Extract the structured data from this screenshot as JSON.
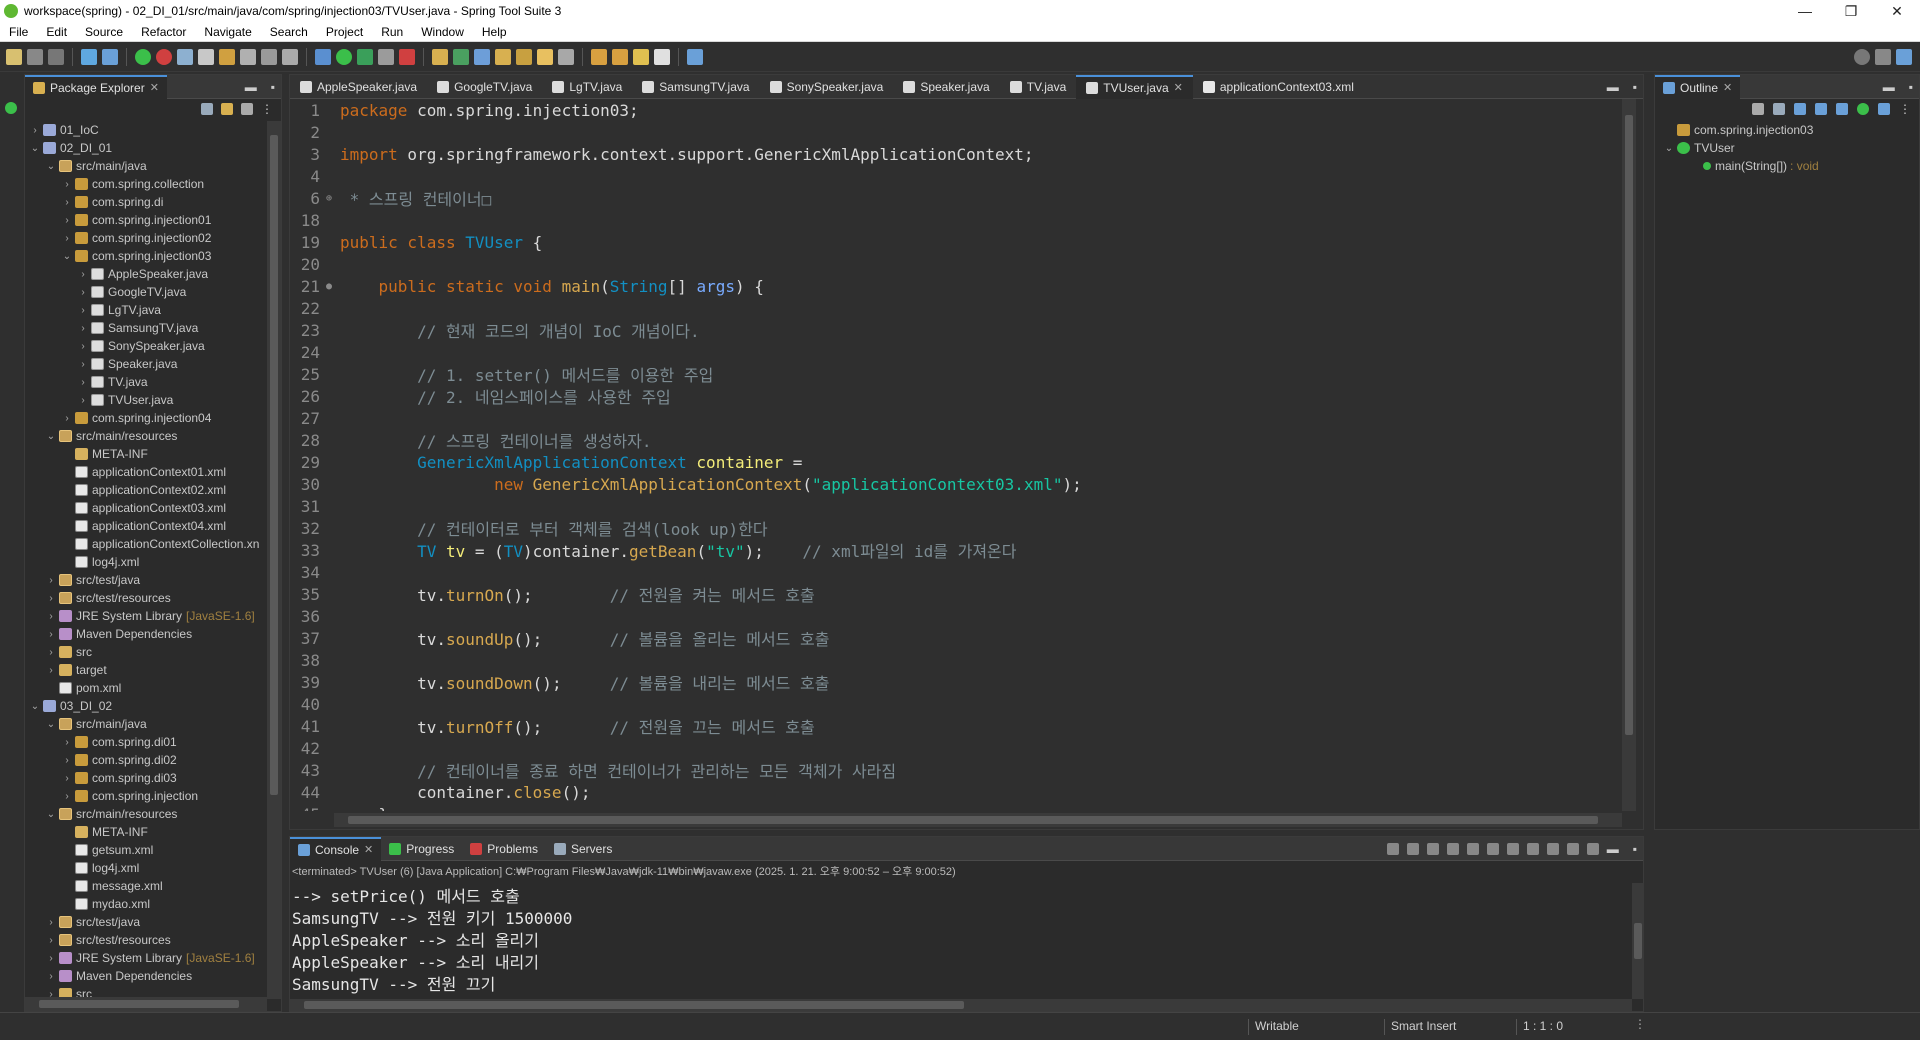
{
  "window": {
    "title": "workspace(spring) - 02_DI_01/src/main/java/com/spring/injection03/TVUser.java - Spring Tool Suite 3",
    "controls": [
      "—",
      "❐",
      "✕"
    ]
  },
  "menu": [
    "File",
    "Edit",
    "Source",
    "Refactor",
    "Navigate",
    "Search",
    "Project",
    "Run",
    "Window",
    "Help"
  ],
  "package_explorer": {
    "tab_label": "Package Explorer",
    "items": [
      {
        "indent": 0,
        "twisty": "›",
        "icon": "proj",
        "label": "01_IoC",
        "extra": ""
      },
      {
        "indent": 0,
        "twisty": "⌄",
        "icon": "proj",
        "label": "02_DI_01",
        "extra": ""
      },
      {
        "indent": 1,
        "twisty": "⌄",
        "icon": "src",
        "label": "src/main/java",
        "extra": ""
      },
      {
        "indent": 2,
        "twisty": "›",
        "icon": "pkg",
        "label": "com.spring.collection",
        "extra": ""
      },
      {
        "indent": 2,
        "twisty": "›",
        "icon": "pkg",
        "label": "com.spring.di",
        "extra": ""
      },
      {
        "indent": 2,
        "twisty": "›",
        "icon": "pkg",
        "label": "com.spring.injection01",
        "extra": ""
      },
      {
        "indent": 2,
        "twisty": "›",
        "icon": "pkg",
        "label": "com.spring.injection02",
        "extra": ""
      },
      {
        "indent": 2,
        "twisty": "⌄",
        "icon": "pkg",
        "label": "com.spring.injection03",
        "extra": ""
      },
      {
        "indent": 3,
        "twisty": "›",
        "icon": "java",
        "label": "AppleSpeaker.java",
        "extra": ""
      },
      {
        "indent": 3,
        "twisty": "›",
        "icon": "java",
        "label": "GoogleTV.java",
        "extra": ""
      },
      {
        "indent": 3,
        "twisty": "›",
        "icon": "java",
        "label": "LgTV.java",
        "extra": ""
      },
      {
        "indent": 3,
        "twisty": "›",
        "icon": "java",
        "label": "SamsungTV.java",
        "extra": ""
      },
      {
        "indent": 3,
        "twisty": "›",
        "icon": "java",
        "label": "SonySpeaker.java",
        "extra": ""
      },
      {
        "indent": 3,
        "twisty": "›",
        "icon": "java",
        "label": "Speaker.java",
        "extra": ""
      },
      {
        "indent": 3,
        "twisty": "›",
        "icon": "java",
        "label": "TV.java",
        "extra": ""
      },
      {
        "indent": 3,
        "twisty": "›",
        "icon": "java",
        "label": "TVUser.java",
        "extra": ""
      },
      {
        "indent": 2,
        "twisty": "›",
        "icon": "pkg",
        "label": "com.spring.injection04",
        "extra": ""
      },
      {
        "indent": 1,
        "twisty": "⌄",
        "icon": "src",
        "label": "src/main/resources",
        "extra": ""
      },
      {
        "indent": 2,
        "twisty": "",
        "icon": "folder",
        "label": "META-INF",
        "extra": ""
      },
      {
        "indent": 2,
        "twisty": "",
        "icon": "xml",
        "label": "applicationContext01.xml",
        "extra": ""
      },
      {
        "indent": 2,
        "twisty": "",
        "icon": "xml",
        "label": "applicationContext02.xml",
        "extra": ""
      },
      {
        "indent": 2,
        "twisty": "",
        "icon": "xml",
        "label": "applicationContext03.xml",
        "extra": ""
      },
      {
        "indent": 2,
        "twisty": "",
        "icon": "xml",
        "label": "applicationContext04.xml",
        "extra": ""
      },
      {
        "indent": 2,
        "twisty": "",
        "icon": "xml",
        "label": "applicationContextCollection.xn",
        "extra": ""
      },
      {
        "indent": 2,
        "twisty": "",
        "icon": "xml",
        "label": "log4j.xml",
        "extra": ""
      },
      {
        "indent": 1,
        "twisty": "›",
        "icon": "src",
        "label": "src/test/java",
        "extra": ""
      },
      {
        "indent": 1,
        "twisty": "›",
        "icon": "src",
        "label": "src/test/resources",
        "extra": ""
      },
      {
        "indent": 1,
        "twisty": "›",
        "icon": "lib",
        "label": "JRE System Library",
        "extra": "[JavaSE-1.6]"
      },
      {
        "indent": 1,
        "twisty": "›",
        "icon": "lib",
        "label": "Maven Dependencies",
        "extra": ""
      },
      {
        "indent": 1,
        "twisty": "›",
        "icon": "folder",
        "label": "src",
        "extra": ""
      },
      {
        "indent": 1,
        "twisty": "›",
        "icon": "folder",
        "label": "target",
        "extra": ""
      },
      {
        "indent": 1,
        "twisty": "",
        "icon": "xml",
        "label": "pom.xml",
        "extra": ""
      },
      {
        "indent": 0,
        "twisty": "⌄",
        "icon": "proj",
        "label": "03_DI_02",
        "extra": ""
      },
      {
        "indent": 1,
        "twisty": "⌄",
        "icon": "src",
        "label": "src/main/java",
        "extra": ""
      },
      {
        "indent": 2,
        "twisty": "›",
        "icon": "pkg",
        "label": "com.spring.di01",
        "extra": ""
      },
      {
        "indent": 2,
        "twisty": "›",
        "icon": "pkg",
        "label": "com.spring.di02",
        "extra": ""
      },
      {
        "indent": 2,
        "twisty": "›",
        "icon": "pkg",
        "label": "com.spring.di03",
        "extra": ""
      },
      {
        "indent": 2,
        "twisty": "›",
        "icon": "pkg",
        "label": "com.spring.injection",
        "extra": ""
      },
      {
        "indent": 1,
        "twisty": "⌄",
        "icon": "src",
        "label": "src/main/resources",
        "extra": ""
      },
      {
        "indent": 2,
        "twisty": "",
        "icon": "folder",
        "label": "META-INF",
        "extra": ""
      },
      {
        "indent": 2,
        "twisty": "",
        "icon": "xml",
        "label": "getsum.xml",
        "extra": ""
      },
      {
        "indent": 2,
        "twisty": "",
        "icon": "xml",
        "label": "log4j.xml",
        "extra": ""
      },
      {
        "indent": 2,
        "twisty": "",
        "icon": "xml",
        "label": "message.xml",
        "extra": ""
      },
      {
        "indent": 2,
        "twisty": "",
        "icon": "xml",
        "label": "mydao.xml",
        "extra": ""
      },
      {
        "indent": 1,
        "twisty": "›",
        "icon": "src",
        "label": "src/test/java",
        "extra": ""
      },
      {
        "indent": 1,
        "twisty": "›",
        "icon": "src",
        "label": "src/test/resources",
        "extra": ""
      },
      {
        "indent": 1,
        "twisty": "›",
        "icon": "lib",
        "label": "JRE System Library",
        "extra": "[JavaSE-1.6]"
      },
      {
        "indent": 1,
        "twisty": "›",
        "icon": "lib",
        "label": "Maven Dependencies",
        "extra": ""
      },
      {
        "indent": 1,
        "twisty": "›",
        "icon": "folder",
        "label": "src",
        "extra": ""
      }
    ]
  },
  "editor": {
    "tabs": [
      {
        "label": "AppleSpeaker.java",
        "active": false
      },
      {
        "label": "GoogleTV.java",
        "active": false
      },
      {
        "label": "LgTV.java",
        "active": false
      },
      {
        "label": "SamsungTV.java",
        "active": false
      },
      {
        "label": "SonySpeaker.java",
        "active": false
      },
      {
        "label": "Speaker.java",
        "active": false
      },
      {
        "label": "TV.java",
        "active": false
      },
      {
        "label": "TVUser.java",
        "active": true
      },
      {
        "label": "applicationContext03.xml",
        "active": false
      }
    ],
    "lines": [
      {
        "n": "1",
        "m": "",
        "seg": [
          [
            "kw",
            "package"
          ],
          [
            "df",
            " com.spring.injection03;"
          ]
        ]
      },
      {
        "n": "2",
        "m": "",
        "seg": []
      },
      {
        "n": "3",
        "m": "",
        "seg": [
          [
            "kw",
            "import"
          ],
          [
            "df",
            " org.springframework.context.support.GenericXmlApplicationContext;"
          ]
        ]
      },
      {
        "n": "4",
        "m": "",
        "seg": []
      },
      {
        "n": "6",
        "m": "⊕",
        "seg": [
          [
            "cm",
            " * 스프링 컨테이너□"
          ]
        ]
      },
      {
        "n": "18",
        "m": "",
        "seg": []
      },
      {
        "n": "19",
        "m": "",
        "seg": [
          [
            "kw",
            "public class "
          ],
          [
            "ty",
            "TVUser"
          ],
          [
            "df",
            " {"
          ]
        ]
      },
      {
        "n": "20",
        "m": "",
        "seg": []
      },
      {
        "n": "21",
        "m": "●",
        "seg": [
          [
            "df",
            "    "
          ],
          [
            "kw",
            "public static void "
          ],
          [
            "fn",
            "main"
          ],
          [
            "df",
            "("
          ],
          [
            "ty",
            "String"
          ],
          [
            "df",
            "[] "
          ],
          [
            "pm",
            "args"
          ],
          [
            "df",
            ") {"
          ]
        ]
      },
      {
        "n": "22",
        "m": "",
        "seg": []
      },
      {
        "n": "23",
        "m": "",
        "seg": [
          [
            "cm",
            "        // 현재 코드의 개념이 IoC 개념이다."
          ]
        ]
      },
      {
        "n": "24",
        "m": "",
        "seg": []
      },
      {
        "n": "25",
        "m": "",
        "seg": [
          [
            "cm",
            "        // 1. setter() 메서드를 이용한 주입"
          ]
        ]
      },
      {
        "n": "26",
        "m": "",
        "seg": [
          [
            "cm",
            "        // 2. 네임스페이스를 사용한 주입"
          ]
        ]
      },
      {
        "n": "27",
        "m": "",
        "seg": []
      },
      {
        "n": "28",
        "m": "",
        "seg": [
          [
            "cm",
            "        // 스프링 컨테이너를 생성하자."
          ]
        ]
      },
      {
        "n": "29",
        "m": "",
        "seg": [
          [
            "df",
            "        "
          ],
          [
            "ty",
            "GenericXmlApplicationContext"
          ],
          [
            "df",
            " "
          ],
          [
            "vr",
            "container"
          ],
          [
            "df",
            " ="
          ]
        ]
      },
      {
        "n": "30",
        "m": "",
        "seg": [
          [
            "df",
            "                "
          ],
          [
            "kw",
            "new "
          ],
          [
            "fn",
            "GenericXmlApplicationContext"
          ],
          [
            "df",
            "("
          ],
          [
            "st",
            "\"applicationContext03.xml\""
          ],
          [
            "df",
            ");"
          ]
        ]
      },
      {
        "n": "31",
        "m": "",
        "seg": []
      },
      {
        "n": "32",
        "m": "",
        "seg": [
          [
            "cm",
            "        // 컨테이터로 부터 객체를 검색(look up)한다"
          ]
        ]
      },
      {
        "n": "33",
        "m": "",
        "seg": [
          [
            "df",
            "        "
          ],
          [
            "ty",
            "TV"
          ],
          [
            "df",
            " "
          ],
          [
            "vr",
            "tv"
          ],
          [
            "df",
            " = ("
          ],
          [
            "ty",
            "TV"
          ],
          [
            "df",
            ")container."
          ],
          [
            "fn",
            "getBean"
          ],
          [
            "df",
            "("
          ],
          [
            "st",
            "\"tv\""
          ],
          [
            "df",
            ");    "
          ],
          [
            "cm",
            "// xml파일의 id를 가져온다"
          ]
        ]
      },
      {
        "n": "34",
        "m": "",
        "seg": []
      },
      {
        "n": "35",
        "m": "",
        "seg": [
          [
            "df",
            "        tv."
          ],
          [
            "fn",
            "turnOn"
          ],
          [
            "df",
            "();        "
          ],
          [
            "cm",
            "// 전원을 켜는 메서드 호출"
          ]
        ]
      },
      {
        "n": "36",
        "m": "",
        "seg": []
      },
      {
        "n": "37",
        "m": "",
        "seg": [
          [
            "df",
            "        tv."
          ],
          [
            "fn",
            "soundUp"
          ],
          [
            "df",
            "();       "
          ],
          [
            "cm",
            "// 볼륨을 올리는 메서드 호출"
          ]
        ]
      },
      {
        "n": "38",
        "m": "",
        "seg": []
      },
      {
        "n": "39",
        "m": "",
        "seg": [
          [
            "df",
            "        tv."
          ],
          [
            "fn",
            "soundDown"
          ],
          [
            "df",
            "();     "
          ],
          [
            "cm",
            "// 볼륨을 내리는 메서드 호출"
          ]
        ]
      },
      {
        "n": "40",
        "m": "",
        "seg": []
      },
      {
        "n": "41",
        "m": "",
        "seg": [
          [
            "df",
            "        tv."
          ],
          [
            "fn",
            "turnOff"
          ],
          [
            "df",
            "();       "
          ],
          [
            "cm",
            "// 전원을 끄는 메서드 호출"
          ]
        ]
      },
      {
        "n": "42",
        "m": "",
        "seg": []
      },
      {
        "n": "43",
        "m": "",
        "seg": [
          [
            "cm",
            "        // 컨테이너를 종료 하면 컨테이너가 관리하는 모든 객체가 사라짐"
          ]
        ]
      },
      {
        "n": "44",
        "m": "",
        "seg": [
          [
            "df",
            "        container."
          ],
          [
            "fn",
            "close"
          ],
          [
            "df",
            "();"
          ]
        ]
      },
      {
        "n": "45",
        "m": "",
        "seg": [
          [
            "df",
            "    }"
          ]
        ]
      }
    ]
  },
  "outline": {
    "tab_label": "Outline",
    "items": [
      {
        "indent": 0,
        "label": "com.spring.injection03",
        "extra": ""
      },
      {
        "indent": 0,
        "label": "TVUser",
        "extra": ""
      },
      {
        "indent": 1,
        "label": "main(String[])",
        "extra": ": void"
      }
    ]
  },
  "console": {
    "tabs": [
      "Console",
      "Progress",
      "Problems",
      "Servers"
    ],
    "terminated": "<terminated> TVUser (6) [Java Application] C:₩Program Files₩Java₩jdk-11₩bin₩javaw.exe  (2025. 1. 21. 오후 9:00:52 – 오후 9:00:52)",
    "lines": [
      "--> setPrice() 메서드 호출",
      "SamsungTV --> 전원 키기 1500000",
      "AppleSpeaker --> 소리 올리기",
      "AppleSpeaker --> 소리 내리기",
      "SamsungTV --> 전원 끄기"
    ]
  },
  "status": {
    "writable": "Writable",
    "insert_mode": "Smart Insert",
    "position": "1 : 1 : 0"
  }
}
